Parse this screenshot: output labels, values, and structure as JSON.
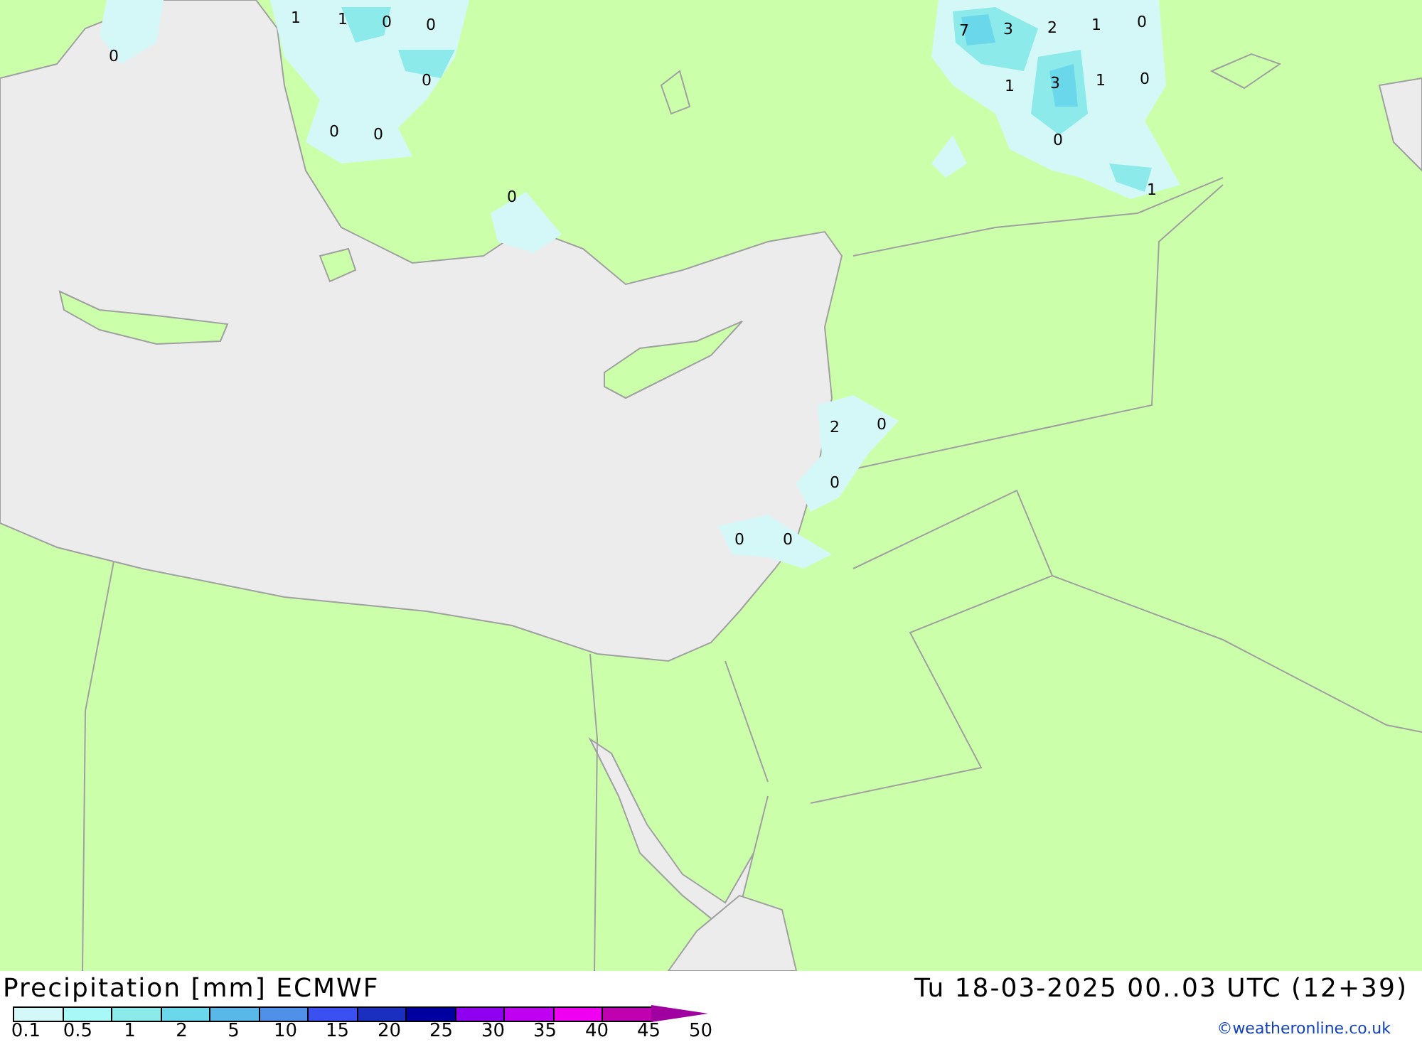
{
  "map": {
    "labels": [
      "1",
      "1",
      "0",
      "0",
      "0",
      "0",
      "0",
      "0",
      "0",
      "7",
      "3",
      "2",
      "1",
      "0",
      "1",
      "3",
      "1",
      "0",
      "0",
      "1",
      "2",
      "0",
      "0",
      "0",
      "0"
    ]
  },
  "footer": {
    "title": "Precipitation [mm] ECMWF",
    "valid_time": "Tu 18-03-2025 00..03 UTC (12+39)",
    "credit": "©weatheronline.co.uk"
  },
  "legend": [
    {
      "label": "0.1",
      "color": "#d4f8f8"
    },
    {
      "label": "0.5",
      "color": "#a8f8f8"
    },
    {
      "label": "1",
      "color": "#8ceaea"
    },
    {
      "label": "2",
      "color": "#6ad8ea"
    },
    {
      "label": "5",
      "color": "#5ab8e8"
    },
    {
      "label": "10",
      "color": "#5090e8"
    },
    {
      "label": "15",
      "color": "#3a50f0"
    },
    {
      "label": "20",
      "color": "#1a2ec0"
    },
    {
      "label": "25",
      "color": "#0000a0"
    },
    {
      "label": "30",
      "color": "#9000f0"
    },
    {
      "label": "35",
      "color": "#c000f0"
    },
    {
      "label": "40",
      "color": "#f000f0"
    },
    {
      "label": "45",
      "color": "#c000b0"
    },
    {
      "label": "50",
      "color": "#a000a0"
    }
  ]
}
